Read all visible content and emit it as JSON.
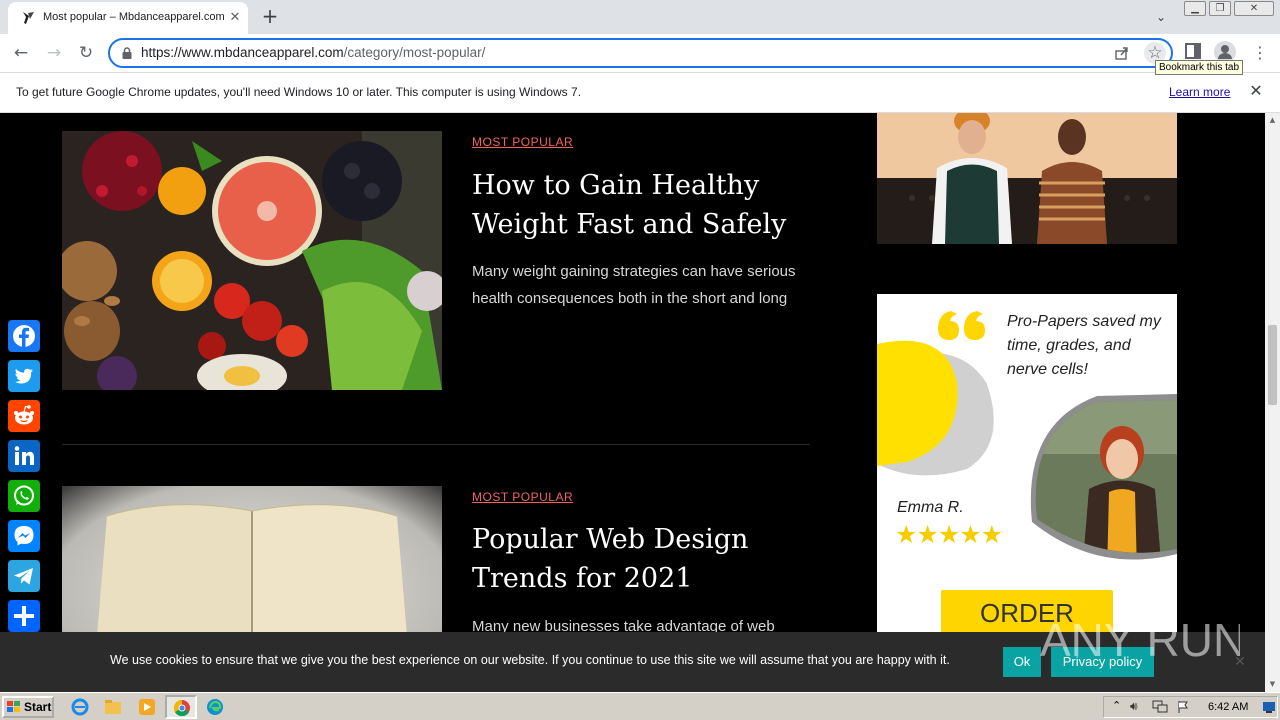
{
  "browser": {
    "tab_title": "Most popular – Mbdanceapparel.com",
    "tab_close_glyph": "✕",
    "new_tab_glyph": "+",
    "url_host": "https://www.mbdanceapparel.com",
    "url_path": "/category/most-popular/",
    "tooltip": "Bookmark this tab",
    "back_glyph": "←",
    "forward_glyph": "→",
    "reload_glyph": "↻",
    "star_glyph": "☆",
    "menu_glyph": "⋮",
    "tab_search_glyph": "⌄",
    "window_buttons": [
      "▁",
      "❐",
      "✕"
    ]
  },
  "infobar": {
    "message": "To get future Google Chrome updates, you'll need Windows 10 or later. This computer is using Windows 7.",
    "learn_more": "Learn more",
    "close_glyph": "✕"
  },
  "articles": [
    {
      "category": "MOST POPULAR",
      "title": "How to Gain Healthy Weight Fast and Safely",
      "excerpt": "Many weight gaining strategies can have serious health consequences both in the short and long"
    },
    {
      "category": "MOST POPULAR",
      "title": "Popular Web Design Trends for 2021",
      "excerpt": "Many new businesses take advantage of web"
    }
  ],
  "ad": {
    "quote": "Pro-Papers saved my time, grades, and nerve cells!",
    "reviewer": "Emma R.",
    "stars": "★★★★★",
    "rating": 5,
    "cta": "ORDER",
    "accent": "#ffd500"
  },
  "share_icons": [
    {
      "name": "facebook-icon",
      "color": "#1877f2"
    },
    {
      "name": "twitter-icon",
      "color": "#1d9bf0"
    },
    {
      "name": "reddit-icon",
      "color": "#ff4500"
    },
    {
      "name": "linkedin-icon",
      "color": "#0a66c2"
    },
    {
      "name": "whatsapp-icon",
      "color": "#12af0a"
    },
    {
      "name": "messenger-icon",
      "color": "#0084ff"
    },
    {
      "name": "telegram-icon",
      "color": "#2ca5e0"
    },
    {
      "name": "share-plus-icon",
      "color": "#0166ff"
    }
  ],
  "cookie": {
    "message": "We use cookies to ensure that we give you the best experience on our website. If you continue to use this site we will assume that you are happy with it.",
    "ok": "Ok",
    "privacy": "Privacy policy",
    "close_glyph": "✕",
    "button_color": "#0aa3a3"
  },
  "watermark": {
    "text": "ANY RUN"
  },
  "taskbar": {
    "start": "Start",
    "clock": "6:42 AM"
  },
  "colors": {
    "accent_category": "#f0645f",
    "chrome_focus": "#1a73e8"
  }
}
